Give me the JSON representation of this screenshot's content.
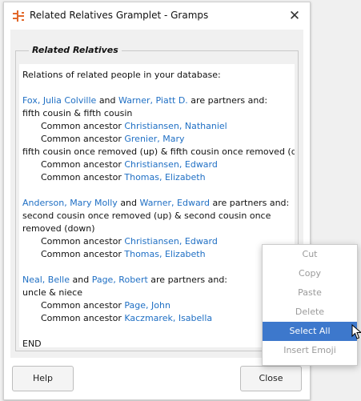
{
  "window": {
    "title": "Related Relatives Gramplet - Gramps",
    "close_glyph": "✕"
  },
  "frame_label": "Related Relatives",
  "intro": "Relations of related people in your database:",
  "groups": [
    {
      "person1": "Fox, Julia Colville",
      "connector": "and",
      "person2": "Warner, Piatt D.",
      "suffix": "are partners and:",
      "relations": [
        {
          "text": "fifth cousin & fifth cousin",
          "ancestors": [
            "Christiansen, Nathaniel",
            "Grenier, Mary"
          ]
        },
        {
          "text": "fifth cousin once removed (up) & fifth cousin once removed (down)",
          "ancestors": [
            "Christiansen, Edward",
            "Thomas, Elizabeth"
          ]
        }
      ]
    },
    {
      "person1": "Anderson, Mary Molly",
      "connector": "and",
      "person2": "Warner, Edward",
      "suffix": "are partners and:",
      "relations": [
        {
          "text": "second cousin once removed (up) & second cousin once removed (down)",
          "ancestors": [
            "Christiansen, Edward",
            "Thomas, Elizabeth"
          ]
        }
      ]
    },
    {
      "person1": "Neal, Belle",
      "connector": "and",
      "person2": "Page, Robert",
      "suffix": "are partners and:",
      "relations": [
        {
          "text": "uncle & niece",
          "ancestors": [
            "Page, John",
            "Kaczmarek, Isabella"
          ]
        }
      ]
    }
  ],
  "common_ancestor_prefix": "Common ancestor",
  "end_text": "END",
  "buttons": {
    "help": "Help",
    "close": "Close"
  },
  "context_menu": {
    "items": [
      {
        "label": "Cut",
        "enabled": false,
        "active": false
      },
      {
        "label": "Copy",
        "enabled": false,
        "active": false
      },
      {
        "label": "Paste",
        "enabled": false,
        "active": false
      },
      {
        "label": "Delete",
        "enabled": false,
        "active": false
      },
      {
        "label": "Select All",
        "enabled": true,
        "active": true
      },
      {
        "label": "Insert Emoji",
        "enabled": false,
        "active": false
      }
    ]
  },
  "colors": {
    "link": "#1f6fc4",
    "menu_highlight": "#3d78cc",
    "icon_orange": "#e2682a"
  }
}
